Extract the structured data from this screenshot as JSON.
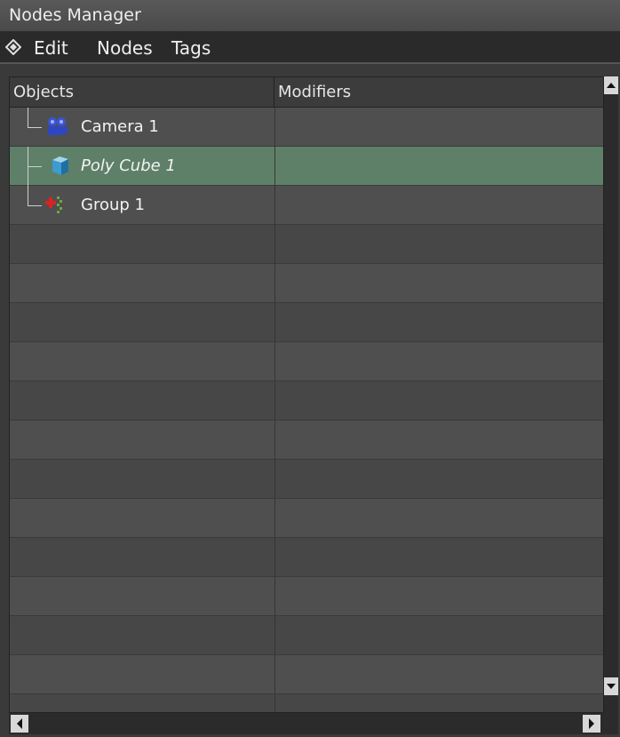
{
  "window": {
    "title": "Nodes Manager"
  },
  "menu": {
    "items": [
      {
        "label": "Edit"
      },
      {
        "label": "Nodes"
      },
      {
        "label": "Tags"
      }
    ]
  },
  "columns": {
    "objects": "Objects",
    "modifiers": "Modifiers"
  },
  "nodes": [
    {
      "label": "Camera 1",
      "icon": "camera-icon",
      "selected": false
    },
    {
      "label": "Poly Cube 1",
      "icon": "cube-icon",
      "selected": true
    },
    {
      "label": "Group 1",
      "icon": "group-icon",
      "selected": false
    }
  ],
  "colors": {
    "selected_row": "#5e8068"
  }
}
